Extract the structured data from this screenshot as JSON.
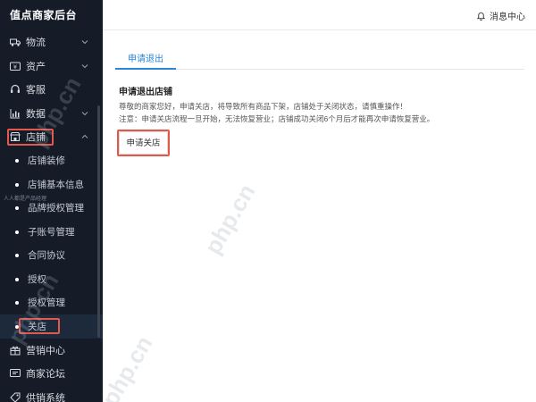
{
  "brand": "值点商家后台",
  "sidebar": {
    "top_items": [
      {
        "label": "物流",
        "icon": "truck-icon",
        "has_chevron": true
      },
      {
        "label": "资产",
        "icon": "wallet-icon",
        "has_chevron": true
      },
      {
        "label": "客服",
        "icon": "headset-icon",
        "has_chevron": false
      },
      {
        "label": "数据",
        "icon": "bar-chart-icon",
        "has_chevron": true
      },
      {
        "label": "店铺",
        "icon": "store-icon",
        "has_chevron": true
      }
    ],
    "sub_items": [
      {
        "label": "店铺装修"
      },
      {
        "label": "店铺基本信息"
      },
      {
        "label": "品牌授权管理"
      },
      {
        "label": "子账号管理"
      },
      {
        "label": "合同协议"
      },
      {
        "label": "授权"
      },
      {
        "label": "授权管理"
      },
      {
        "label": "关店"
      }
    ],
    "bottom_items": [
      {
        "label": "营销中心",
        "icon": "gift-icon"
      },
      {
        "label": "商家论坛",
        "icon": "forum-icon"
      },
      {
        "label": "供销系统",
        "icon": "tag-icon"
      }
    ],
    "overlay_text": "人人都是产品经理"
  },
  "topbar": {
    "notification_label": "消息中心"
  },
  "main": {
    "tab_label": "申请退出",
    "section_title": "申请退出店铺",
    "desc_line1": "尊敬的商家您好，申请关店，将导致所有商品下架，店铺处于关闭状态，请慎重操作！",
    "desc_line2": "注意：申请关店流程一旦开始，无法恢复营业；店铺成功关闭6个月后才能再次申请恢复营业。",
    "apply_button": "申请关店"
  },
  "watermark": "php.cn",
  "colors": {
    "sidebar_bg": "#151c28",
    "accent": "#2a86d6",
    "highlight_red": "#e3584d"
  }
}
